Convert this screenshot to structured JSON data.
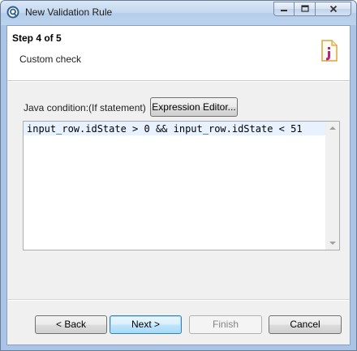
{
  "window": {
    "title": "New Validation Rule",
    "app_icon": "talend-q-icon",
    "controls": {
      "minimize_icon": "minimize-icon",
      "maximize_icon": "maximize-icon",
      "close_icon": "close-icon"
    }
  },
  "header": {
    "step": "Step 4 of 5",
    "description": "Custom check",
    "wizard_icon": "code-file-icon"
  },
  "condition": {
    "label": "Java condition:(If statement)",
    "expression_editor_button": "Expression Editor...",
    "code": "input_row.idState > 0 && input_row.idState < 51"
  },
  "footer": {
    "back": "< Back",
    "next": "Next >",
    "finish": "Finish",
    "cancel": "Cancel"
  },
  "colors": {
    "title_bar": "#bcd3ee",
    "current_line": "#e8f2fe",
    "default_button_border": "#3c7fb1",
    "icon_accent": "#b0277a",
    "icon_frame": "#d9a441"
  }
}
